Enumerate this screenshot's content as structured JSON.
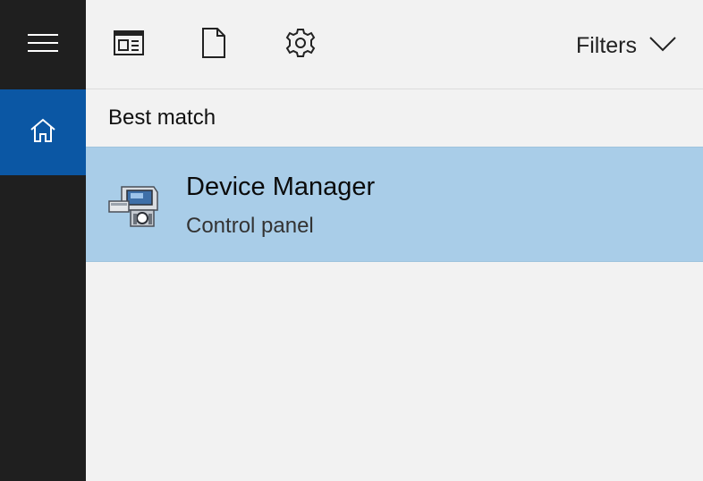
{
  "rail": {
    "menu_icon": "hamburger-icon",
    "home_icon": "home-icon",
    "home_active_color": "#0b57a4"
  },
  "toolbar": {
    "icons": [
      "apps-icon",
      "documents-icon",
      "settings-gear-icon"
    ],
    "filters_label": "Filters",
    "filters_icon": "chevron-down-icon"
  },
  "results": {
    "section_title": "Best match",
    "best_match": {
      "title": "Device Manager",
      "subtitle": "Control panel",
      "icon": "device-manager-icon",
      "highlight_color": "#a9cde8"
    }
  }
}
